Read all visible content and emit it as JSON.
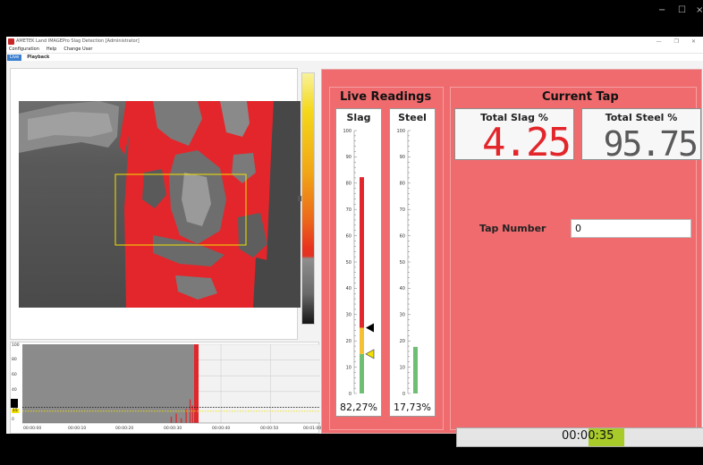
{
  "app": {
    "title": "AMETEK Land IMAGEPro Slag Detection [Administrator]",
    "menu": [
      "Configuration",
      "Help",
      "Change User"
    ],
    "tabs": [
      "Live",
      "Playback"
    ]
  },
  "os_controls": {
    "minimize": "−",
    "maximize": "☐",
    "close": "×"
  },
  "window_controls": {
    "minimize": "—",
    "restore": "❐",
    "close": "✕"
  },
  "chart": {
    "y_ticks": [
      "100",
      "80",
      "60",
      "40",
      "20",
      "0"
    ],
    "x_ticks": [
      "00:00:00",
      "00:00:10",
      "00:00:20",
      "00:00:30",
      "00:00:40",
      "00:00:50",
      "00:01:00"
    ],
    "threshold_labels": [
      "20",
      "15"
    ]
  },
  "live_readings": {
    "title": "Live Readings",
    "slag": {
      "label": "Slag",
      "percent": "82,27%",
      "fill_percent": 82.27,
      "marker_black": 25,
      "marker_yellow": 15
    },
    "steel": {
      "label": "Steel",
      "percent": "17,73%",
      "fill_percent": 17.73
    },
    "ticks": [
      "100",
      "90",
      "80",
      "70",
      "60",
      "50",
      "40",
      "30",
      "20",
      "10",
      "0"
    ]
  },
  "current_tap": {
    "title": "Current Tap",
    "total_slag_label": "Total Slag %",
    "total_slag_value": "4.25",
    "total_steel_label": "Total Steel %",
    "total_steel_value": "95.75",
    "tap_number_label": "Tap Number",
    "tap_number_value": "0",
    "timer": "00:00:35",
    "timer_progress": 0.5
  },
  "colors": {
    "panel_bg": "#ef6b6e",
    "slag_red": "#e3262b",
    "steel_green": "#6fbf73",
    "timer_green": "#a8cb2a",
    "warning_yellow": "#f5c133"
  }
}
